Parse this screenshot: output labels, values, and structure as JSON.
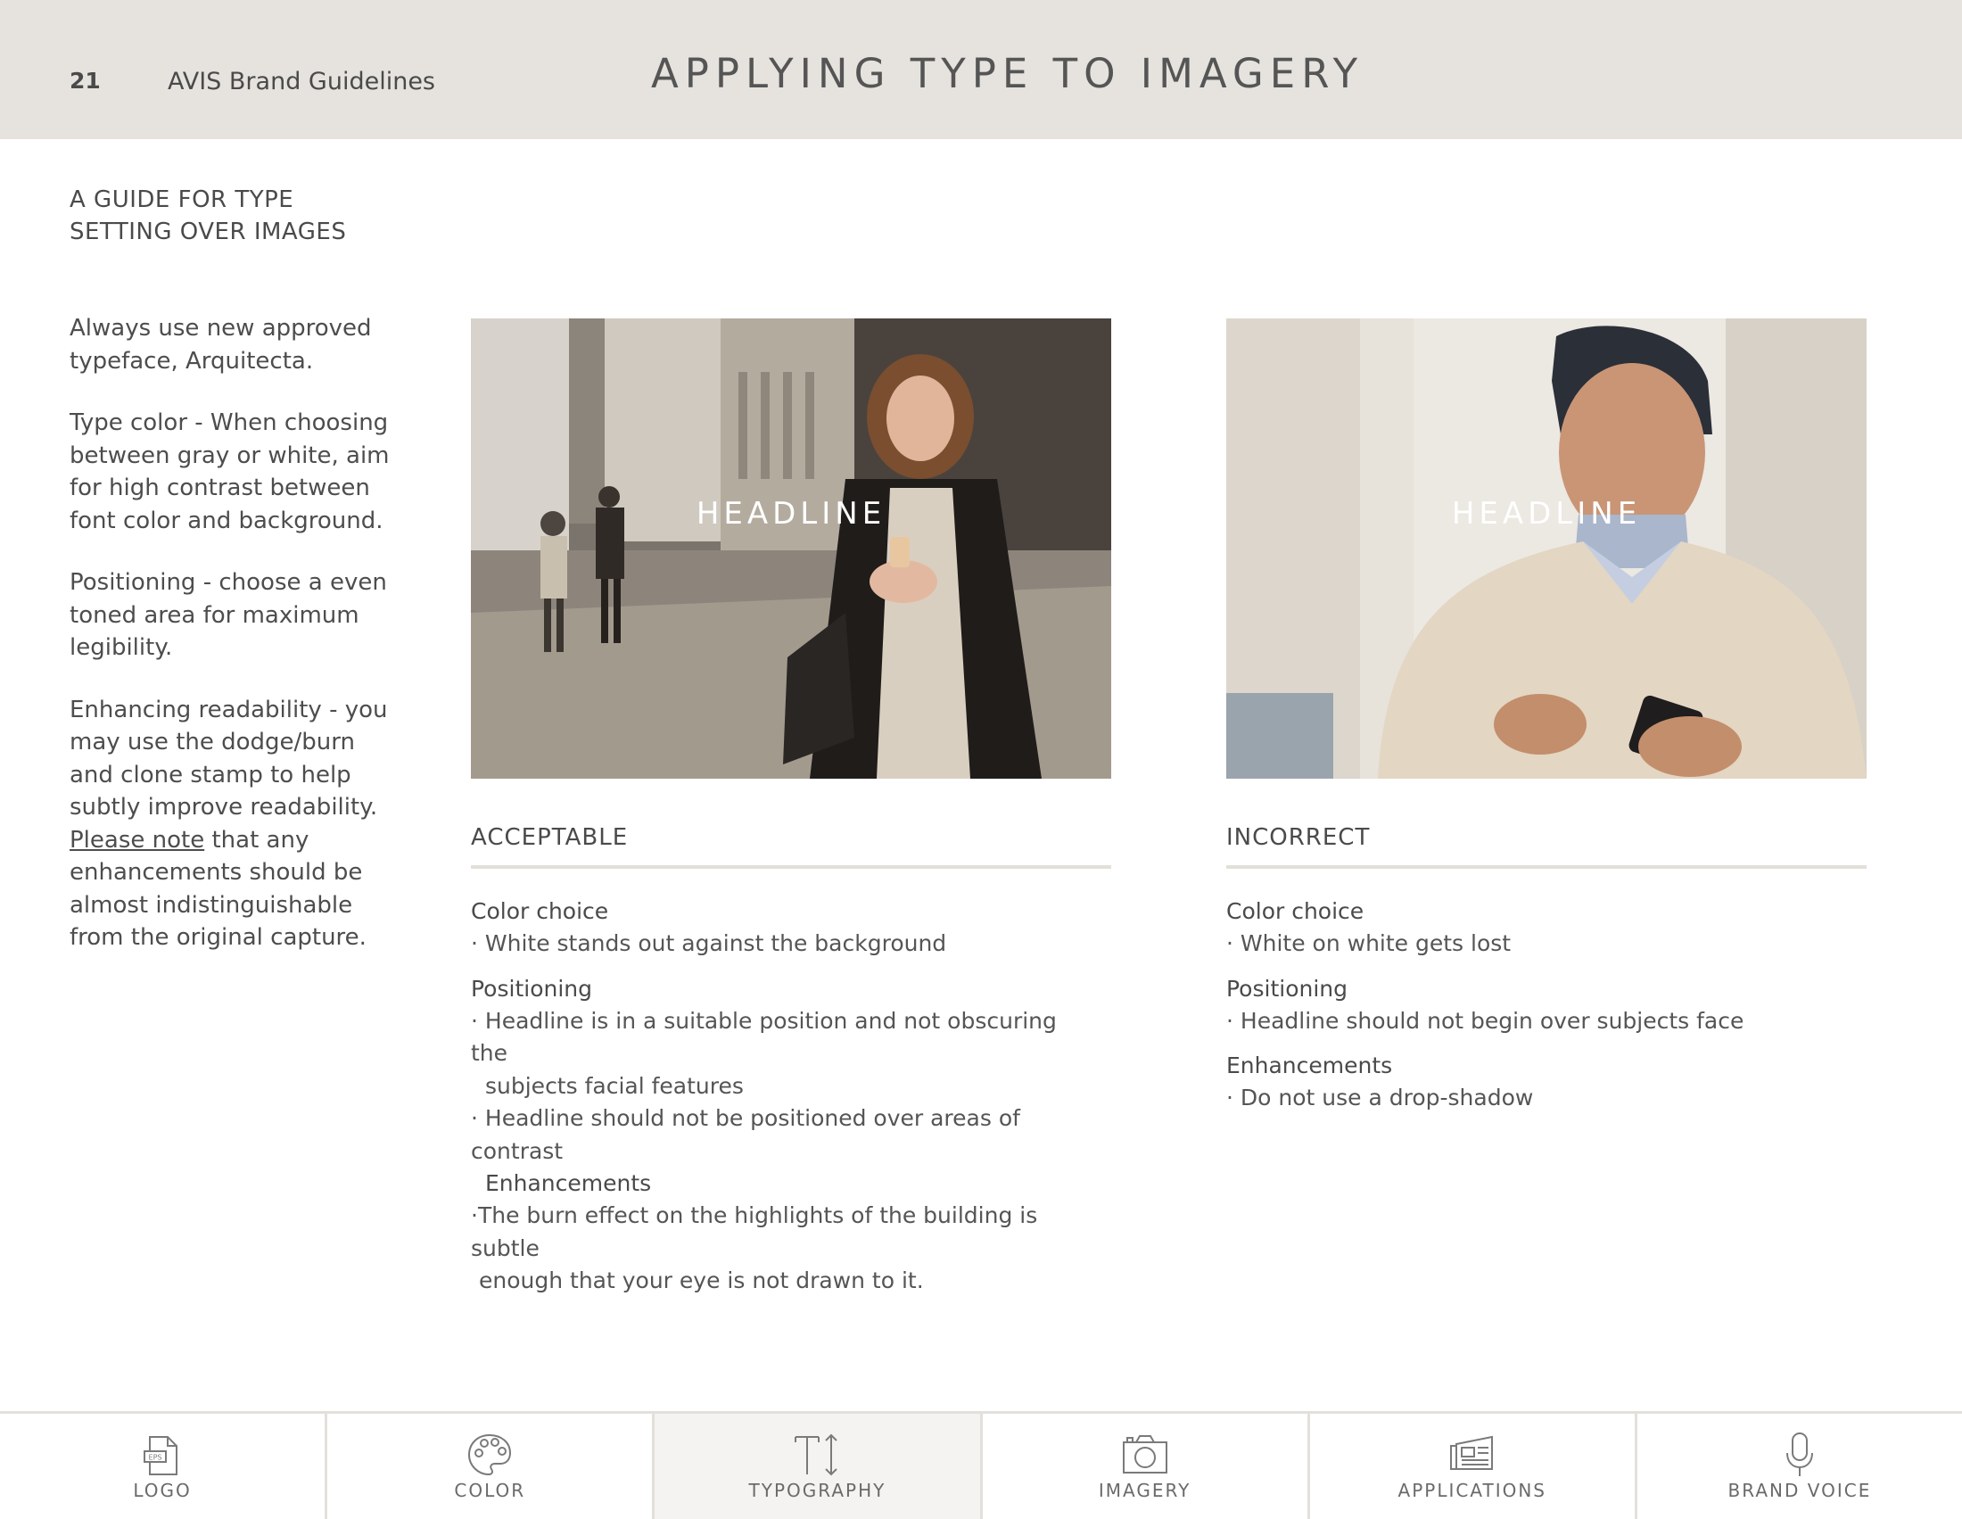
{
  "header": {
    "page_number": "21",
    "brand_name": "AVIS",
    "brand_suffix": " Brand Guidelines",
    "title": "APPLYING TYPE TO IMAGERY"
  },
  "guide": {
    "title_line1": "A GUIDE FOR TYPE",
    "title_line2": "SETTING OVER IMAGES"
  },
  "left_text": {
    "p1": "Always use new approved typeface, Arquitecta.",
    "p2": "Type color - When choosing between gray or white, aim for high contrast between font color and background.",
    "p3": "Positioning - choose a even    toned area for maximum legibility.",
    "p4_start": "Enhancing readability - you may use the dodge/burn and clone stamp to help subtly improve readability. ",
    "p4_link": "Please note",
    "p4_end": " that any enhancements should be almost indistinguishable from the original capture."
  },
  "examples": [
    {
      "overlay": "HEADLINE",
      "heading": "ACCEPTABLE",
      "color_title": "Color choice",
      "color_line": "· White stands out against the background",
      "pos_title": "Positioning",
      "pos_line1": "· Headline is in a suitable position and not obscuring the",
      "pos_line1b": "subjects facial features",
      "pos_line2": "· Headline should not be positioned over areas of contrast",
      "enh_title": "Enhancements",
      "enh_line1": "·The burn effect on the highlights of the building is subtle",
      "enh_line1b": "enough that your eye is not drawn to it."
    },
    {
      "overlay": "HEADLINE",
      "heading": "INCORRECT",
      "color_title": "Color choice",
      "color_line": "· White on white gets lost",
      "pos_title": "Positioning",
      "pos_line1": "· Headline should not begin over subjects face",
      "enh_title": "Enhancements",
      "enh_line1": "· Do not use a drop-shadow"
    }
  ],
  "nav": [
    {
      "label": "LOGO",
      "icon": "eps-file-icon"
    },
    {
      "label": "COLOR",
      "icon": "palette-icon"
    },
    {
      "label": "TYPOGRAPHY",
      "icon": "text-size-icon",
      "active": true
    },
    {
      "label": "IMAGERY",
      "icon": "camera-icon"
    },
    {
      "label": "APPLICATIONS",
      "icon": "newspaper-icon"
    },
    {
      "label": "BRAND VOICE",
      "icon": "microphone-icon"
    }
  ]
}
